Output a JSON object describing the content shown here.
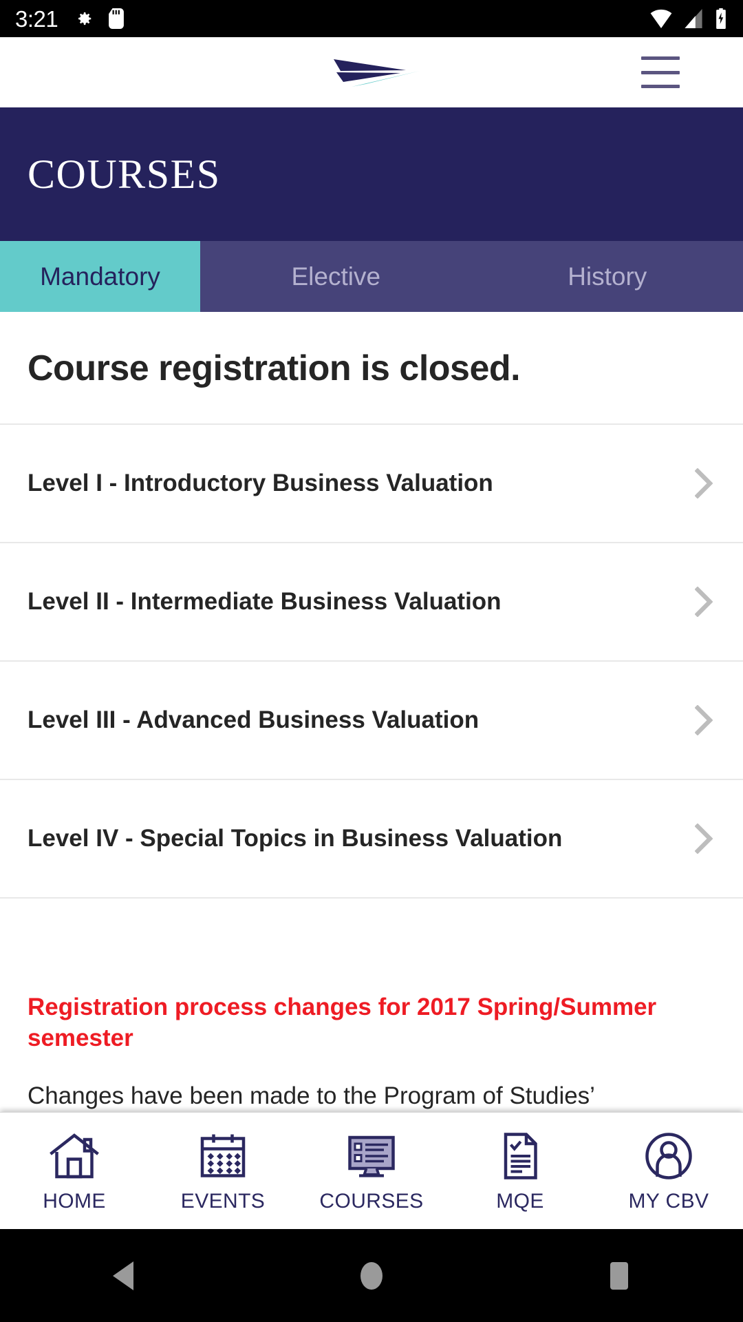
{
  "status_bar": {
    "time": "3:21",
    "left_icons": [
      "gear-icon",
      "sd-card-icon"
    ],
    "right_icons": [
      "wifi-icon",
      "cell-signal-icon",
      "battery-charging-icon"
    ]
  },
  "app_bar": {
    "logo_name": "cbv-paper-plane-logo",
    "menu_name": "hamburger-menu-icon",
    "colors": {
      "navy": "#25225c",
      "teal": "#63cbca"
    }
  },
  "page_header": {
    "title": "COURSES",
    "background": "#25225c"
  },
  "tabs": {
    "active_index": 0,
    "items": [
      {
        "label": "Mandatory",
        "active": true
      },
      {
        "label": "Elective",
        "active": false
      },
      {
        "label": "History",
        "active": false
      }
    ],
    "active_bg": "#63cbca",
    "inactive_bg": "#464379"
  },
  "main": {
    "headline": "Course registration is closed.",
    "courses": [
      {
        "title": "Level I - Introductory Business Valuation"
      },
      {
        "title": "Level II - Intermediate Business Valuation"
      },
      {
        "title": "Level III - Advanced Business Valuation"
      },
      {
        "title": "Level IV - Special Topics in Business Valuation"
      }
    ],
    "notice": {
      "title": "Registration process changes for 2017 Spring/Summer semester",
      "title_color": "#ee1c24",
      "body": "Changes have been made to the Program of Studies’"
    }
  },
  "bottom_nav": {
    "items": [
      {
        "label": "HOME",
        "icon": "house-icon"
      },
      {
        "label": "EVENTS",
        "icon": "calendar-icon"
      },
      {
        "label": "COURSES",
        "icon": "monitor-list-icon"
      },
      {
        "label": "MQE",
        "icon": "document-check-icon"
      },
      {
        "label": "MY CBV",
        "icon": "user-circle-icon"
      }
    ],
    "color": "#2b2860"
  },
  "android_nav": {
    "buttons": [
      {
        "name": "back-button",
        "icon": "triangle-left-icon"
      },
      {
        "name": "home-button",
        "icon": "circle-icon"
      },
      {
        "name": "recents-button",
        "icon": "square-icon"
      }
    ]
  }
}
